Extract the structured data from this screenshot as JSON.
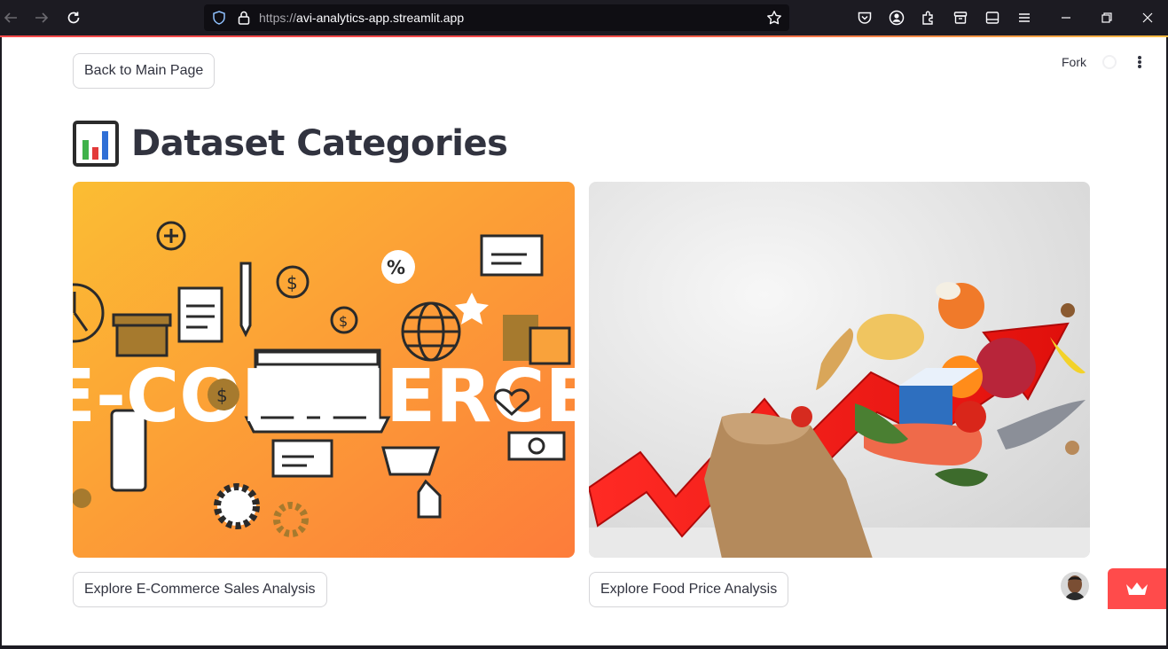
{
  "browser": {
    "url_protocol": "https://",
    "url_host": "avi-analytics-app.streamlit.app",
    "icons": [
      "back-arrow-icon",
      "forward-arrow-icon",
      "reload-icon",
      "shield-icon",
      "lock-icon",
      "bookmark-star-icon",
      "pocket-icon",
      "account-icon",
      "extensions-icon",
      "container-icon",
      "sidebar-icon",
      "menu-icon",
      "minimize-icon",
      "restore-icon",
      "close-icon"
    ]
  },
  "toolbar": {
    "back_button": "Back to Main Page",
    "fork_label": "Fork"
  },
  "main": {
    "title": "Dataset Categories",
    "title_icon": "bar-chart-icon",
    "cards": [
      {
        "image_name": "ecommerce-image",
        "image_text": "E-COMMERCE",
        "button": "Explore E-Commerce Sales Analysis"
      },
      {
        "image_name": "food-price-image",
        "button": "Explore Food Price Analysis"
      }
    ]
  },
  "colors": {
    "accent": "#ff4b4b",
    "text": "#31333f",
    "ecommerce_bg": "#fb9a38",
    "food_bg": "#e4e4e4"
  }
}
